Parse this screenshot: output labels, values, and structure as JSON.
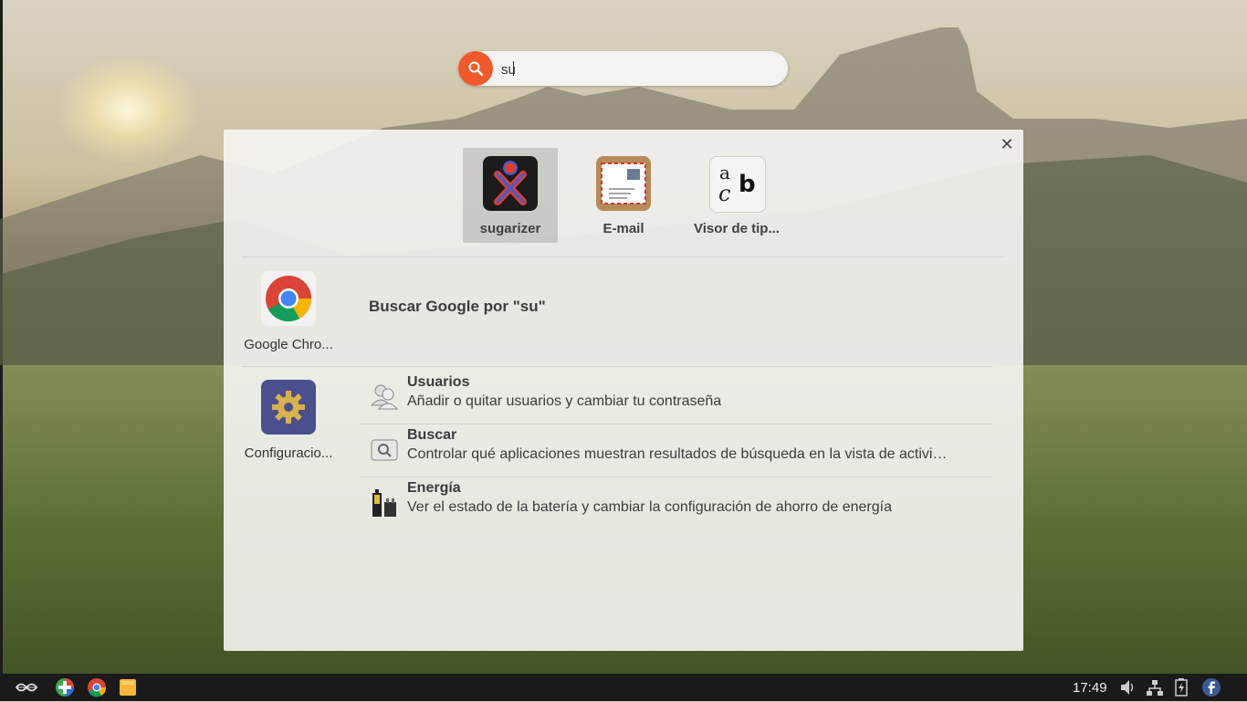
{
  "search": {
    "value": "su",
    "icon": "search-icon"
  },
  "top_apps": [
    {
      "label": "sugarizer",
      "icon": "sugarizer-icon",
      "selected": true
    },
    {
      "label": "E-mail",
      "icon": "email-icon",
      "selected": false
    },
    {
      "label": "Visor de tip...",
      "icon": "font-viewer-icon",
      "selected": false
    }
  ],
  "providers": {
    "chrome": {
      "label": "Google Chro...",
      "icon": "chrome-icon"
    },
    "settings": {
      "label": "Configuracio...",
      "icon": "settings-gear-icon"
    }
  },
  "google_search": {
    "label": "Buscar Google por \"su\""
  },
  "settings_results": [
    {
      "title": "Usuarios",
      "desc": "Añadir o quitar usuarios y cambiar tu contraseña",
      "icon": "users-icon"
    },
    {
      "title": "Buscar",
      "desc": "Controlar qué aplicaciones muestran resultados de búsqueda en la vista de activi…",
      "icon": "search-settings-icon"
    },
    {
      "title": "Energía",
      "desc": "Ver el estado de la batería y cambiar la configuración de ahorro de energía",
      "icon": "power-icon"
    }
  ],
  "taskbar": {
    "clock": "17:49",
    "colors": {
      "accent": "#f0592a",
      "background": "#1a1a1a",
      "facebook": "#3b5998"
    }
  }
}
